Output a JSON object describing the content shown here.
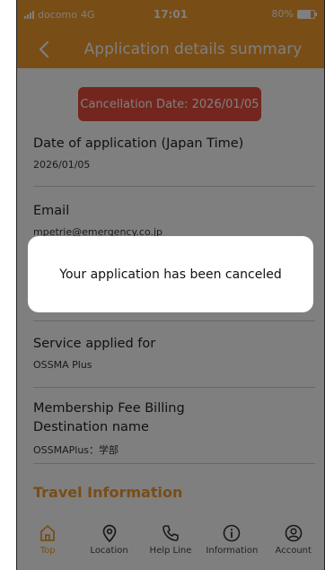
{
  "status_bar": {
    "carrier": "docomo",
    "network": "4G",
    "time": "17:01",
    "battery": "80%",
    "battery_level": 0.8
  },
  "header": {
    "title": "Application details summary",
    "back_icon": "chevron-left-icon"
  },
  "cancellation_badge": "Cancellation Date: 2026/01/05",
  "details": {
    "date_of_application": {
      "label": "Date of application (Japan Time)",
      "value": "2026/01/05"
    },
    "email": {
      "label": "Email",
      "value": "mpetrie@emergency.co.jp"
    },
    "service": {
      "label": "Service applied for",
      "value": "OSSMA Plus"
    },
    "billing": {
      "label_line1": "Membership Fee Billing",
      "label_line2": "Destination name",
      "value": "OSSMAPlus：学部"
    }
  },
  "travel_heading": "Travel Information",
  "dialog": {
    "message": "Your application has been canceled"
  },
  "tabs": [
    {
      "label": "Top",
      "icon": "home-icon",
      "active": true
    },
    {
      "label": "Location",
      "icon": "location-pin-icon",
      "active": false
    },
    {
      "label": "Help Line",
      "icon": "phone-icon",
      "active": false
    },
    {
      "label": "Information",
      "icon": "info-icon",
      "active": false
    },
    {
      "label": "Account",
      "icon": "account-icon",
      "active": false
    }
  ],
  "colors": {
    "accent": "#f39a2c",
    "badge": "#e74c3c",
    "overlay": "rgba(0,0,0,0.5)"
  }
}
